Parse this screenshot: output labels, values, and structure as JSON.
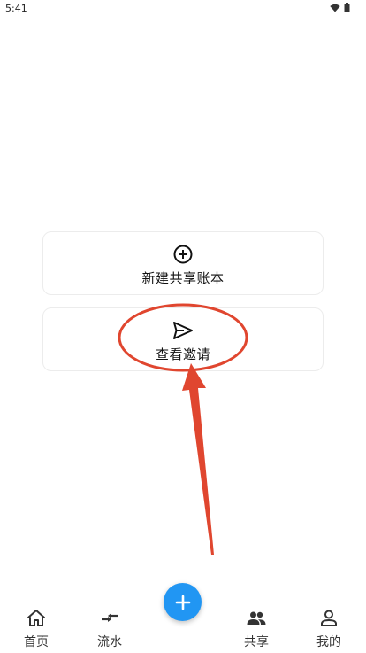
{
  "status_bar": {
    "time": "5:41"
  },
  "cards": {
    "new_ledger": {
      "label": "新建共享账本",
      "icon": "add-circle-icon"
    },
    "view_invite": {
      "label": "查看邀请",
      "icon": "send-icon"
    }
  },
  "bottom_nav": {
    "items": [
      {
        "label": "首页",
        "icon": "home-icon"
      },
      {
        "label": "流水",
        "icon": "transfer-arrows-icon"
      },
      {
        "label": "共享",
        "icon": "people-icon"
      },
      {
        "label": "我的",
        "icon": "person-icon"
      }
    ],
    "fab_icon": "plus-icon"
  },
  "colors": {
    "accent": "#2196f3",
    "annotation": "#e0462f"
  }
}
